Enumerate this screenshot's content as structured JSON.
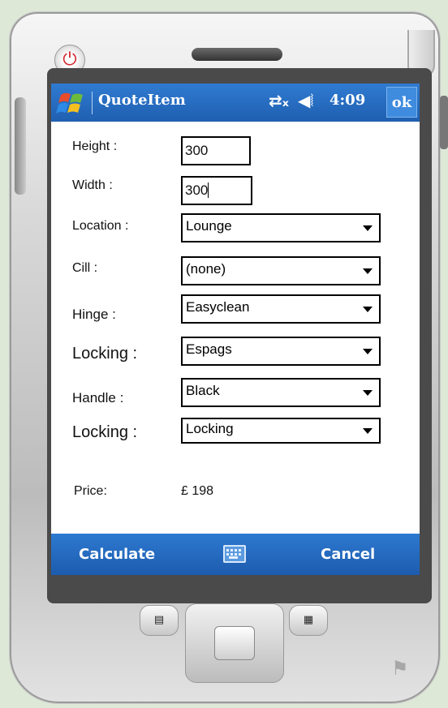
{
  "app": {
    "title": "QuoteItem",
    "time": "4:09",
    "ok_label": "ok"
  },
  "status_icons": {
    "connectivity": "connectivity-x-icon",
    "volume": "speaker-icon"
  },
  "form": {
    "height": {
      "label": "Height :",
      "value": "300"
    },
    "width": {
      "label": "Width :",
      "value": "300"
    },
    "location": {
      "label": "Location :",
      "value": "Lounge"
    },
    "cill": {
      "label": "Cill :",
      "value": "(none)"
    },
    "hinge": {
      "label": "Hinge :",
      "value": "Easyclean"
    },
    "locking1": {
      "label": "Locking :",
      "value": "Espags"
    },
    "handle": {
      "label": "Handle :",
      "value": "Black"
    },
    "locking2": {
      "label": "Locking :",
      "value": "Locking"
    },
    "price": {
      "label": "Price:",
      "value": "£ 198"
    }
  },
  "softkeys": {
    "left": "Calculate",
    "right": "Cancel"
  },
  "colors": {
    "titlebar": "#2f7bd2",
    "softkeybar": "#2d79d0",
    "power": "#d2282f"
  }
}
